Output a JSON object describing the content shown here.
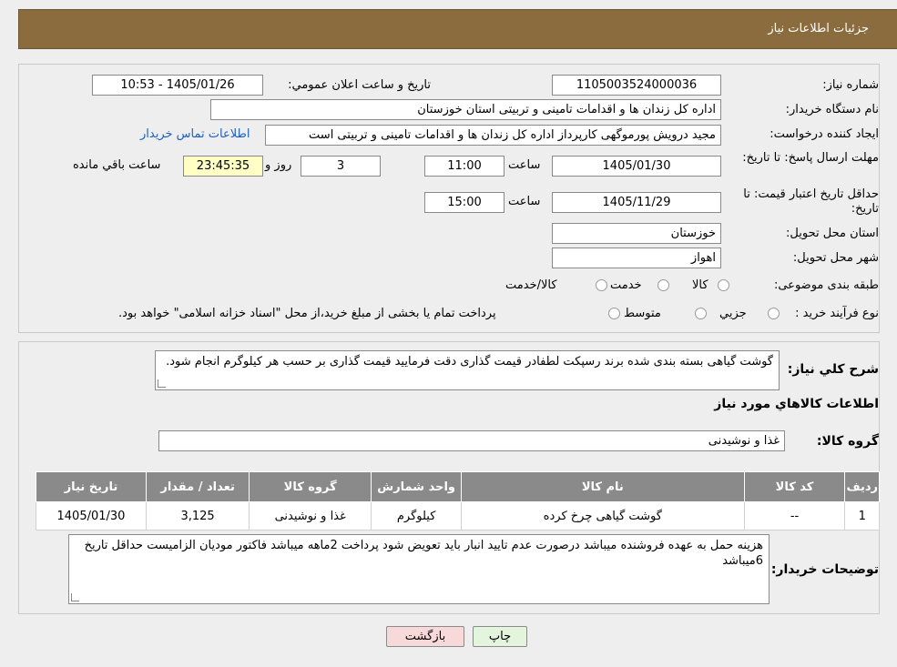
{
  "header": {
    "title": "جزئیات اطلاعات نیاز"
  },
  "form": {
    "need_number_label": "شماره نیاز:",
    "need_number": "1105003524000036",
    "announce_datetime_label": "تاریخ و ساعت اعلان عمومي:",
    "announce_datetime": "1405/01/26 - 10:53",
    "buyer_org_label": "نام دستگاه خريدار:",
    "buyer_org": "اداره کل زندان ها و اقدامات تامینی و تربیتی استان خوزستان",
    "requester_label": "ایجاد کننده درخواست:",
    "requester": "مجید درویش پورموگهی کارپرداز اداره کل زندان ها و اقدامات تامینی و تربیتی است",
    "contact_link": "اطلاعات تماس خریدار",
    "deadline_label": "مهلت ارسال پاسخ: تا تاریخ:",
    "deadline_date": "1405/01/30",
    "time_label": "ساعت",
    "deadline_time": "11:00",
    "days_value": "3",
    "days_label": "روز و",
    "remaining_time": "23:45:35",
    "remaining_label": "ساعت باقي مانده",
    "validity_label": "حداقل تاریخ اعتبار قیمت: تا تاریخ:",
    "validity_date": "1405/11/29",
    "validity_time": "15:00",
    "province_label": "استان محل تحویل:",
    "province": "خوزستان",
    "city_label": "شهر محل تحویل:",
    "city": "اهواز",
    "category_label": "طبقه بندی موضوعی:",
    "category_options": [
      "کالا",
      "خدمت",
      "کالا/خدمت"
    ],
    "process_label": "نوع فرآیند خرید :",
    "process_options": [
      "جزیي",
      "متوسط"
    ],
    "process_note": "پرداخت تمام یا بخشی از مبلغ خرید،از محل \"اسناد خزانه اسلامی\" خواهد بود."
  },
  "details": {
    "description_label": "شرح کلي نياز:",
    "description": "گوشت گیاهی بسته بندی شده برند رسپکت لطفادر قیمت گذاری دقت فرمایید قیمت گذاری بر حسب هر کیلوگرم انجام شود.",
    "items_title": "اطلاعات کالاهاي مورد نياز",
    "group_label": "گروه کالا:",
    "group_value": "غذا و نوشیدنی",
    "table": {
      "headers": [
        "رديف",
        "کد کالا",
        "نام کالا",
        "واحد شمارش",
        "گروه کالا",
        "تعداد / مقدار",
        "تاریخ نیاز"
      ],
      "rows": [
        [
          "1",
          "--",
          "گوشت گیاهی چرخ کرده",
          "کیلوگرم",
          "غذا و نوشیدنی",
          "3,125",
          "1405/01/30"
        ]
      ]
    },
    "buyer_notes_label": "توضیحات خریدار:",
    "buyer_notes": "هزینه حمل به عهده فروشنده میباشد درصورت عدم تایید انبار باید تعویض شود پرداخت 2ماهه میباشد فاکتور مودیان الزامیست حداقل تاریخ 6میباشد"
  },
  "buttons": {
    "print": "چاپ",
    "back": "بازگشت"
  },
  "colors": {
    "header_bg": "#8b6c3f",
    "table_header_bg": "#8a8a8a",
    "back_button_bg": "#f8d9d9",
    "print_button_bg": "#e3f5dc",
    "remaining_bg": "#ffffc5",
    "link": "#1a5fc7"
  }
}
